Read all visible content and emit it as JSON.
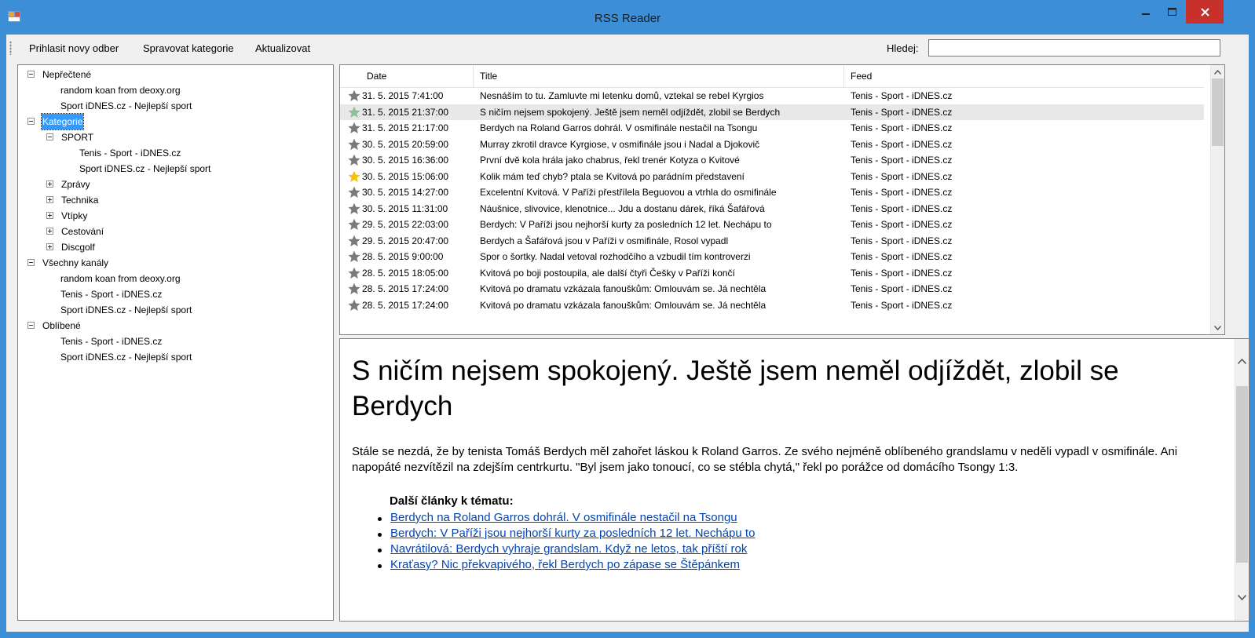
{
  "window": {
    "title": "RSS Reader"
  },
  "toolbar": {
    "subscribe_label": "Prihlasit novy odber",
    "manage_label": "Spravovat kategorie",
    "update_label": "Aktualizovat",
    "search_label": "Hledej:",
    "search_value": ""
  },
  "tree": {
    "unread": {
      "label": "Nepřečtené",
      "items": [
        "random koan from deoxy.org",
        "Sport iDNES.cz - Nejlepší sport"
      ]
    },
    "categories": {
      "label": "Kategorie",
      "sport": {
        "label": "SPORT",
        "items": [
          "Tenis - Sport - iDNES.cz",
          "Sport iDNES.cz - Nejlepší sport"
        ]
      },
      "collapsed": [
        "Zprávy",
        "Technika",
        "Vtípky",
        "Cestování",
        "Discgolf"
      ]
    },
    "all": {
      "label": "Všechny kanály",
      "items": [
        "random koan from deoxy.org",
        "Tenis - Sport - iDNES.cz",
        "Sport iDNES.cz - Nejlepší sport"
      ]
    },
    "favorites": {
      "label": "Oblíbené",
      "items": [
        "Tenis - Sport - iDNES.cz",
        "Sport iDNES.cz - Nejlepší sport"
      ]
    }
  },
  "articles": {
    "columns": [
      "Date",
      "Title",
      "Feed"
    ],
    "selected_index": 1,
    "star_colors": {
      "read": "#7a7a7a",
      "selected": "#8fbf9a",
      "favorite": "#f4c20d"
    },
    "rows": [
      {
        "star": "read",
        "date": "31. 5. 2015 7:41:00",
        "title": "Nesnáším to tu. Zamluvte mi letenku domů, vztekal se rebel Kyrgios",
        "feed": "Tenis - Sport - iDNES.cz"
      },
      {
        "star": "selected",
        "date": "31. 5. 2015 21:37:00",
        "title": "S ničím nejsem spokojený. Ještě jsem neměl odjíždět, zlobil se Berdych",
        "feed": "Tenis - Sport - iDNES.cz"
      },
      {
        "star": "read",
        "date": "31. 5. 2015 21:17:00",
        "title": "Berdych na Roland Garros dohrál. V osmifinále nestačil na Tsongu",
        "feed": "Tenis - Sport - iDNES.cz"
      },
      {
        "star": "read",
        "date": "30. 5. 2015 20:59:00",
        "title": "Murray zkrotil dravce Kyrgiose, v osmifinále jsou i Nadal a Djokovič",
        "feed": "Tenis - Sport - iDNES.cz"
      },
      {
        "star": "read",
        "date": "30. 5. 2015 16:36:00",
        "title": "První dvě kola hrála jako chabrus, řekl trenér Kotyza o Kvitové",
        "feed": "Tenis - Sport - iDNES.cz"
      },
      {
        "star": "favorite",
        "date": "30. 5. 2015 15:06:00",
        "title": "Kolik mám teď chyb? ptala se Kvitová po parádním představení",
        "feed": "Tenis - Sport - iDNES.cz"
      },
      {
        "star": "read",
        "date": "30. 5. 2015 14:27:00",
        "title": "Excelentní Kvitová. V Paříži přestřílela Beguovou a vtrhla do osmifinále",
        "feed": "Tenis - Sport - iDNES.cz"
      },
      {
        "star": "read",
        "date": "30. 5. 2015 11:31:00",
        "title": "Náušnice, slivovice, klenotnice... Jdu a dostanu dárek, říká Šafářová",
        "feed": "Tenis - Sport - iDNES.cz"
      },
      {
        "star": "read",
        "date": "29. 5. 2015 22:03:00",
        "title": "Berdych: V Paříži jsou nejhorší kurty za posledních 12 let. Nechápu to",
        "feed": "Tenis - Sport - iDNES.cz"
      },
      {
        "star": "read",
        "date": "29. 5. 2015 20:47:00",
        "title": "Berdych a Šafářová jsou v Paříži v osmifinále, Rosol vypadl",
        "feed": "Tenis - Sport - iDNES.cz"
      },
      {
        "star": "read",
        "date": "28. 5. 2015 9:00:00",
        "title": "Spor o šortky. Nadal vetoval rozhodčího a vzbudil tím kontroverzi",
        "feed": "Tenis - Sport - iDNES.cz"
      },
      {
        "star": "read",
        "date": "28. 5. 2015 18:05:00",
        "title": "Kvitová po boji postoupila, ale další čtyři Češky v Paříži končí",
        "feed": "Tenis - Sport - iDNES.cz"
      },
      {
        "star": "read",
        "date": "28. 5. 2015 17:24:00",
        "title": "Kvitová po dramatu vzkázala fanouškům: Omlouvám se. Já nechtěla",
        "feed": "Tenis - Sport - iDNES.cz"
      },
      {
        "star": "read",
        "date": "28. 5. 2015 17:24:00",
        "title": "Kvitová po dramatu vzkázala fanouškům: Omlouvám se. Já nechtěla",
        "feed": "Tenis - Sport - iDNES.cz"
      }
    ]
  },
  "preview": {
    "title": "S ničím nejsem spokojený. Ještě jsem neměl odjíždět, zlobil se Berdych",
    "body": "Stále se nezdá, že by tenista Tomáš Berdych měl zahořet láskou k Roland Garros. Ze svého nejméně oblíbeného grandslamu v neděli vypadl v osmifinále. Ani napopáté nezvítězil na zdejším centrkurtu. \"Byl jsem jako tonoucí, co se stébla chytá,\" řekl po porážce od domácího Tsongy 1:3.",
    "related_heading": "Další články k tématu:",
    "related": [
      "Berdych na Roland Garros dohrál. V osmifinále nestačil na Tsongu",
      "Berdych: V Paříži jsou nejhorší kurty za posledních 12 let. Nechápu to",
      "Navrátilová: Berdych vyhraje grandslam. Když ne letos, tak příští rok",
      "Kraťasy? Nic překvapivého, řekl Berdych po zápase se Štěpánkem"
    ]
  }
}
